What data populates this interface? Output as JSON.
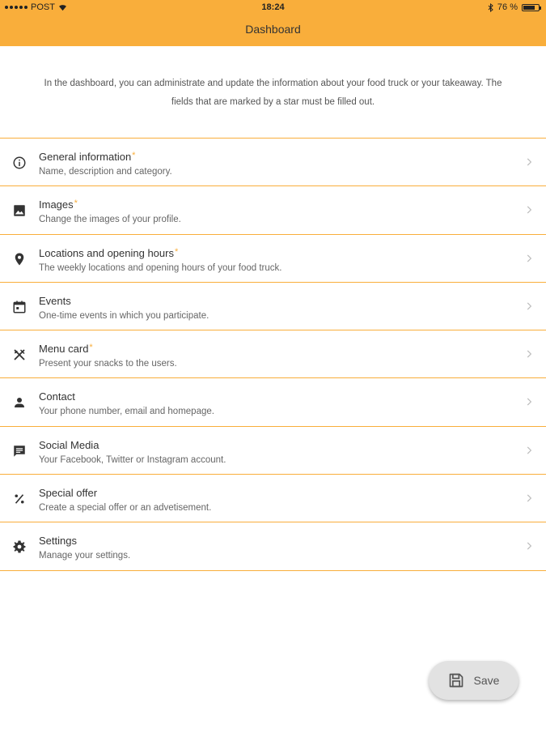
{
  "status": {
    "carrier": "POST",
    "time": "18:24",
    "battery_text": "76 %",
    "battery_level": 0.76
  },
  "header": {
    "title": "Dashboard",
    "color": "#f9ae3b"
  },
  "intro": "In the dashboard, you can administrate and update the information about your food truck or your takeaway. The fields that are marked by a star must be filled out.",
  "star": "*",
  "items": [
    {
      "title": "General information",
      "required": true,
      "subtitle": "Name, description and category.",
      "icon": "info-icon"
    },
    {
      "title": "Images",
      "required": true,
      "subtitle": "Change the images of your profile.",
      "icon": "image-icon"
    },
    {
      "title": "Locations and opening hours",
      "required": true,
      "subtitle": "The weekly locations and opening hours of your food truck.",
      "icon": "location-pin-icon"
    },
    {
      "title": "Events",
      "required": false,
      "subtitle": "One-time events in which you participate.",
      "icon": "calendar-icon"
    },
    {
      "title": "Menu card",
      "required": true,
      "subtitle": "Present your snacks to the users.",
      "icon": "cutlery-icon"
    },
    {
      "title": "Contact",
      "required": false,
      "subtitle": "Your phone number, email and homepage.",
      "icon": "person-icon"
    },
    {
      "title": "Social Media",
      "required": false,
      "subtitle": "Your Facebook, Twitter or Instagram account.",
      "icon": "chat-icon"
    },
    {
      "title": "Special offer",
      "required": false,
      "subtitle": "Create a special offer or an advetisement.",
      "icon": "percent-icon"
    },
    {
      "title": "Settings",
      "required": false,
      "subtitle": "Manage your settings.",
      "icon": "gear-icon"
    }
  ],
  "save": {
    "label": "Save",
    "icon": "save-icon"
  }
}
